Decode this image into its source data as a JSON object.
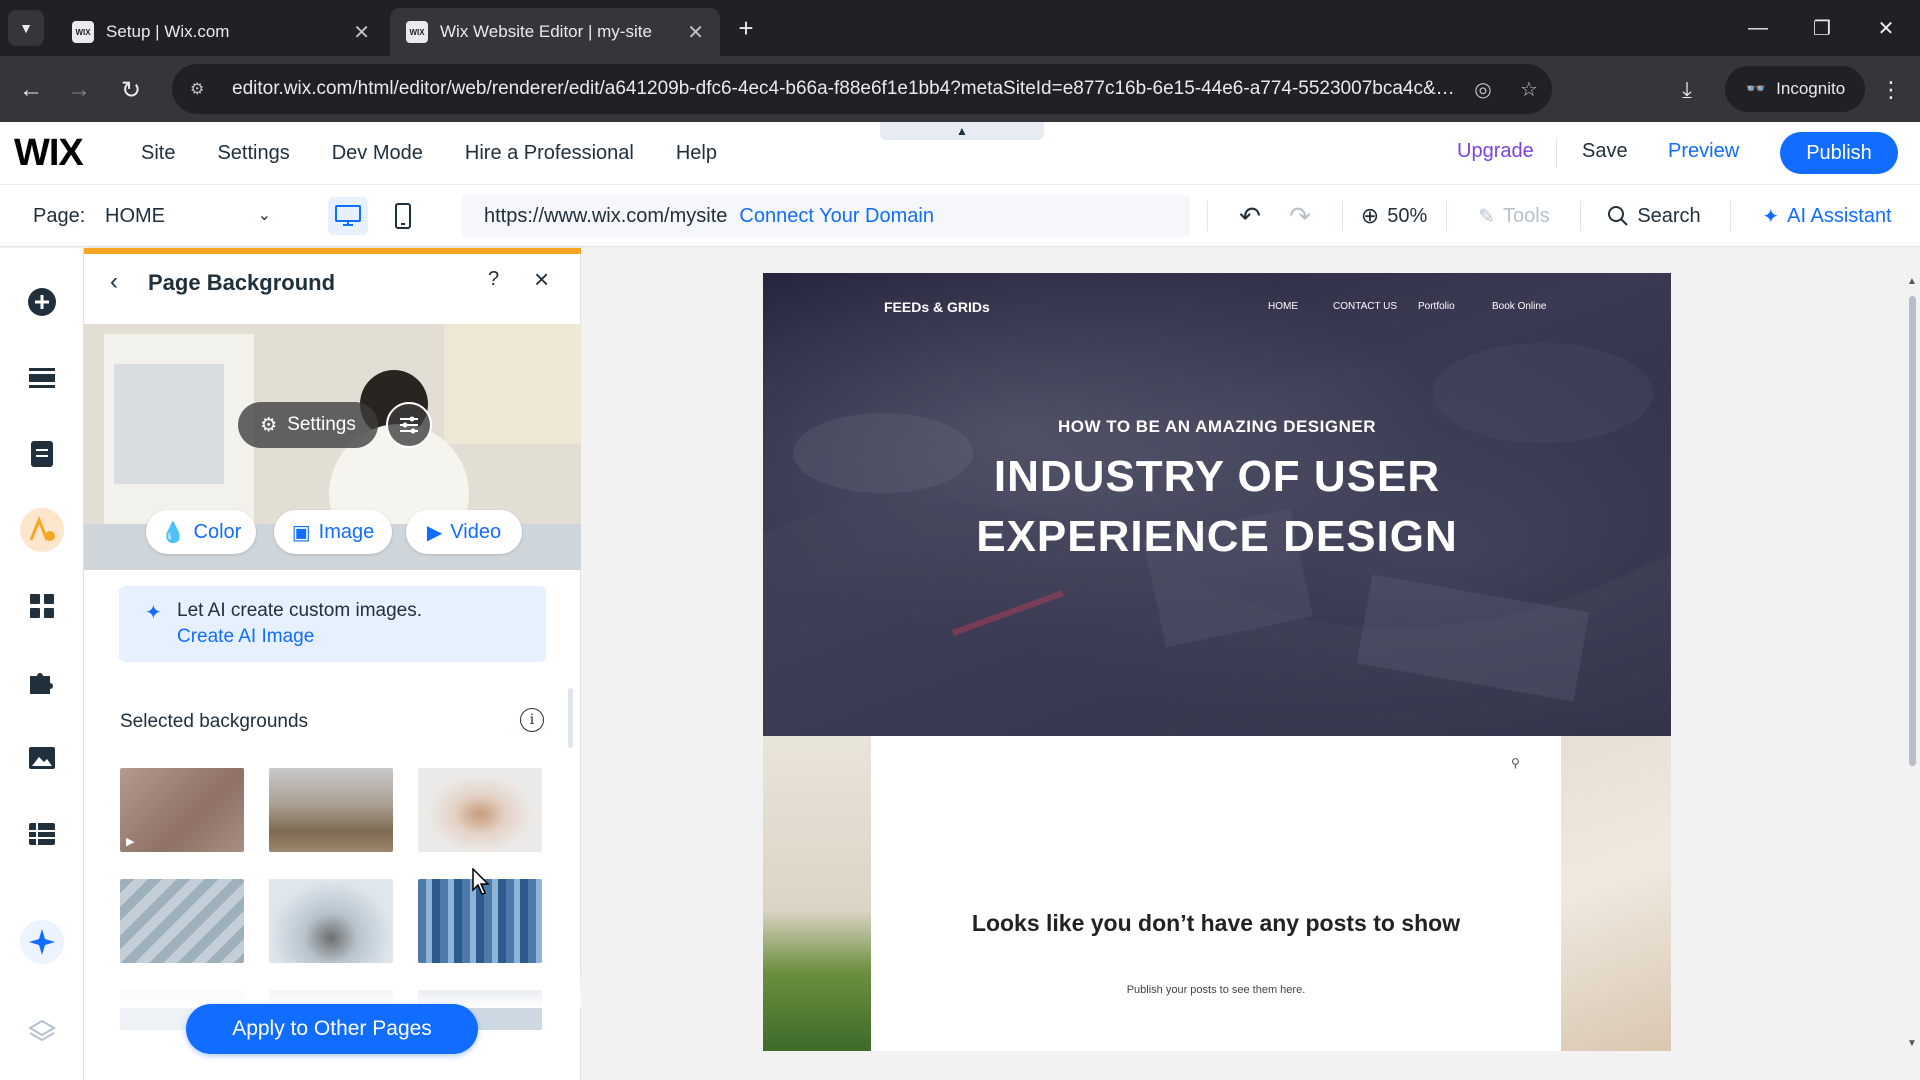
{
  "browser": {
    "tabs": [
      {
        "title": "Setup | Wix.com",
        "favicon": "WIX",
        "active": false
      },
      {
        "title": "Wix Website Editor | my-site",
        "favicon": "WIX",
        "active": true
      }
    ],
    "url": "editor.wix.com/html/editor/web/renderer/edit/a641209b-dfc6-4ec4-b66a-f88e6f1e1bb4?metaSiteId=e877c16b-6e15-44e6-a774-5523007bca4c&edito...",
    "incognito_label": "Incognito"
  },
  "wix_topbar": {
    "logo": "WIX",
    "menu": [
      "Site",
      "Settings",
      "Dev Mode",
      "Hire a Professional",
      "Help"
    ],
    "upgrade": "Upgrade",
    "save": "Save",
    "preview": "Preview",
    "publish": "Publish"
  },
  "pagebar": {
    "page_label": "Page:",
    "page_value": "HOME",
    "site_url": "https://www.wix.com/mysite",
    "connect_domain": "Connect Your Domain",
    "zoom": "50%",
    "tools": "Tools",
    "search": "Search",
    "ai_assistant": "AI Assistant"
  },
  "panel": {
    "title": "Page Background",
    "help": "?",
    "settings_label": "Settings",
    "type_buttons": [
      "Color",
      "Image",
      "Video"
    ],
    "ai_line1": "Let AI create custom images.",
    "ai_line2": "Create AI Image",
    "selected_title": "Selected backgrounds",
    "apply_button": "Apply to Other Pages"
  },
  "site_preview": {
    "logo": "FEEDs & GRIDs",
    "nav": [
      "HOME",
      "CONTACT US",
      "Portfolio",
      "Book Online"
    ],
    "kicker": "HOW TO BE AN AMAZING DESIGNER",
    "title_line1": "INDUSTRY OF USER",
    "title_line2": "EXPERIENCE DESIGN",
    "no_posts": "Looks like you don’t have any posts to show",
    "no_posts_sub": "Publish your posts to see them here."
  },
  "colors": {
    "wix_blue": "#116dff",
    "upgrade_purple": "#7a42e0",
    "panel_accent": "#f5a623"
  }
}
